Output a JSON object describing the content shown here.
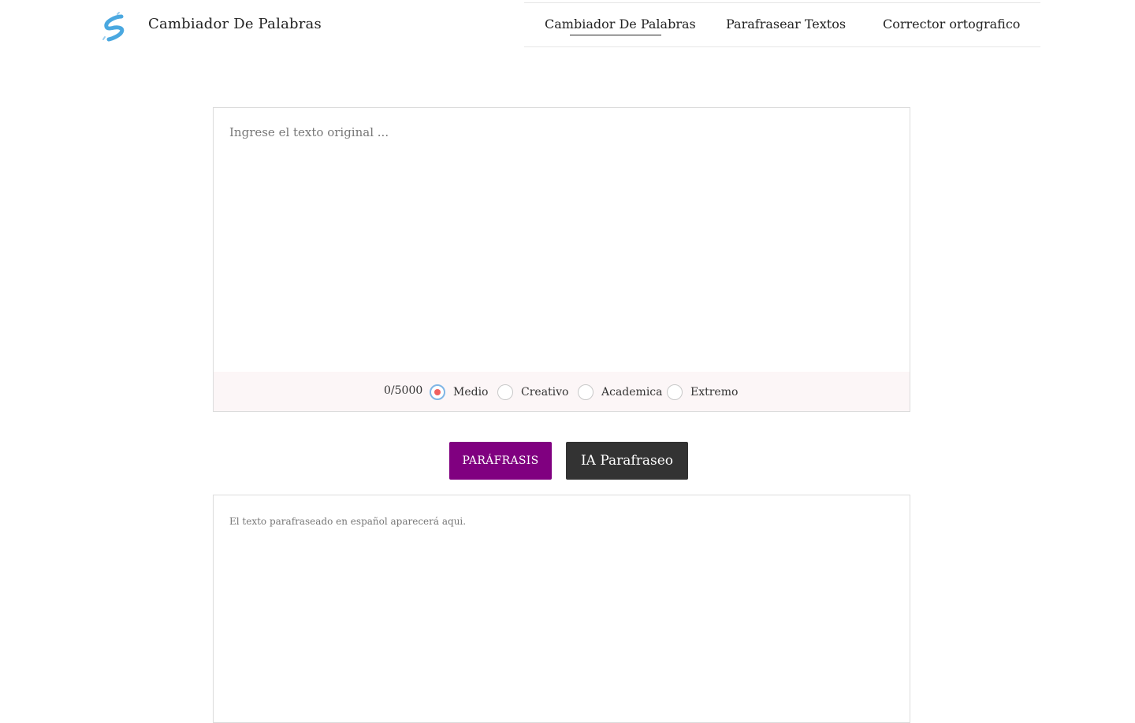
{
  "header": {
    "logo_icon": "paraphrase-logo-icon",
    "brand": "Cambiador De Palabras",
    "nav": [
      {
        "label": "Cambiador De Palabras",
        "active": true
      },
      {
        "label": "Parafrasear Textos",
        "active": false
      },
      {
        "label": "Corrector ortografico",
        "active": false
      }
    ]
  },
  "input": {
    "value": "",
    "placeholder": "Ingrese el texto original ..."
  },
  "controls": {
    "counter": "0/5000",
    "modes": [
      {
        "label": "Medio",
        "selected": true
      },
      {
        "label": "Creativo",
        "selected": false
      },
      {
        "label": "Academica",
        "selected": false
      },
      {
        "label": "Extremo",
        "selected": false
      }
    ]
  },
  "actions": {
    "paraphrase_label": "PARÁFRASIS",
    "ai_label": "IA Parafraseo"
  },
  "output": {
    "placeholder_text": "El texto parafraseado en español aparecerá aqui."
  },
  "colors": {
    "paraphrase_button": "#800080",
    "ai_button": "#333333",
    "logo": "#4aa8e0",
    "radio_dot": "#f06060"
  }
}
